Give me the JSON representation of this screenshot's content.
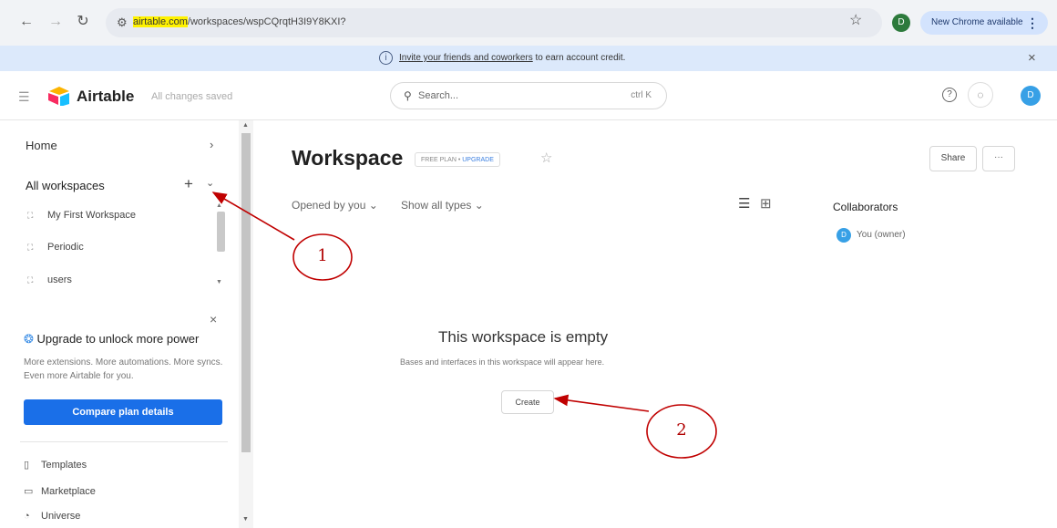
{
  "browser": {
    "url_host": "airtable.com",
    "url_path": "/workspaces/wspCQrqtH3I9Y8KXI?",
    "profile_initial": "D",
    "update_label": "New Chrome available",
    "icons": [
      "back-icon",
      "forward-icon",
      "reload-icon",
      "tune-icon",
      "star-icon",
      "kebab-icon"
    ]
  },
  "banner": {
    "link_text": "Invite your friends and coworkers",
    "rest_text": " to earn account credit.",
    "info_glyph": "i",
    "close_glyph": "×"
  },
  "header": {
    "logo_text": "Airtable",
    "saved_status": "All changes saved",
    "search_placeholder": "Search...",
    "search_shortcut": "ctrl K",
    "avatar_initial": "D"
  },
  "sidebar": {
    "home_label": "Home",
    "all_workspaces_label": "All workspaces",
    "workspaces": [
      {
        "label": "My First Workspace"
      },
      {
        "label": "Periodic"
      },
      {
        "label": "users"
      }
    ],
    "upgrade": {
      "title": "Upgrade to unlock more power",
      "description": "More extensions. More automations. More syncs. Even more Airtable for you.",
      "button_label": "Compare plan details"
    },
    "links": [
      {
        "label": "Templates",
        "icon": "book-icon"
      },
      {
        "label": "Marketplace",
        "icon": "marketplace-icon"
      },
      {
        "label": "Universe",
        "icon": "universe-icon"
      }
    ]
  },
  "main": {
    "title": "Workspace",
    "plan_label": "FREE PLAN",
    "plan_separator": " • ",
    "plan_upgrade": "UPGRADE",
    "share_label": "Share",
    "more_label": "···",
    "filter_opened": "Opened by you",
    "filter_types": "Show all types",
    "collaborators_title": "Collaborators",
    "collaborator_initial": "D",
    "collaborator_name": "You (owner)",
    "empty_title": "This workspace is empty",
    "empty_description": "Bases and interfaces in this workspace will appear here.",
    "create_label": "Create"
  },
  "annotations": {
    "color": "#c00000",
    "callouts": [
      {
        "label": "1",
        "target": "add-workspace-button"
      },
      {
        "label": "2",
        "target": "create-button"
      }
    ]
  }
}
